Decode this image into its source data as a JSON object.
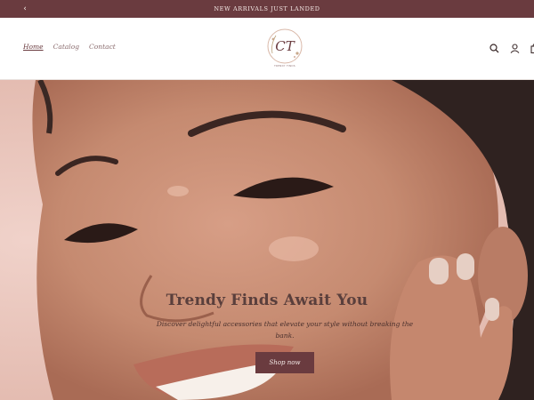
{
  "announcement": {
    "text": "NEW ARRIVALS JUST LANDED",
    "prev_icon": "chevron-left-icon",
    "next_icon": "chevron-right-icon"
  },
  "header": {
    "nav": [
      {
        "label": "Home",
        "active": true
      },
      {
        "label": "Catalog",
        "active": false
      },
      {
        "label": "Contact",
        "active": false
      }
    ],
    "logo": {
      "monogram": "CT",
      "tagline": "TRENDY FINDS"
    },
    "icons": [
      "search-icon",
      "account-icon",
      "cart-icon"
    ]
  },
  "hero": {
    "title": "Trendy Finds Await You",
    "subtitle": "Discover delightful accessories that elevate your style without breaking the bank.",
    "button_label": "Shop now"
  },
  "colors": {
    "brand": "#6a3b3f",
    "nav_text": "#8a6b6d",
    "hero_text": "#5a3f3c"
  }
}
